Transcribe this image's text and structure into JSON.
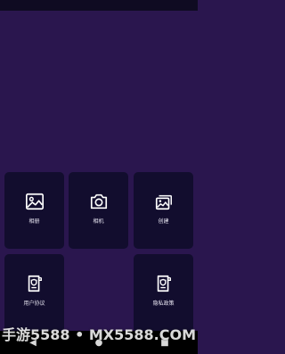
{
  "tiles": {
    "album": {
      "label": "相册",
      "icon": "image-icon"
    },
    "camera": {
      "label": "相机",
      "icon": "camera-icon"
    },
    "create": {
      "label": "创建",
      "icon": "images-stack-icon"
    },
    "user_agreement": {
      "label": "用户协议",
      "icon": "document-shield-icon"
    },
    "privacy_policy": {
      "label": "隐私政策",
      "icon": "document-shield-icon"
    }
  },
  "nav": {
    "back": "◀",
    "home": "●",
    "recent": "■"
  },
  "watermark": "手游5588 • MX5588.COM",
  "colors": {
    "background": "#2a164e",
    "tile": "#120d2e",
    "nav": "#000000"
  }
}
